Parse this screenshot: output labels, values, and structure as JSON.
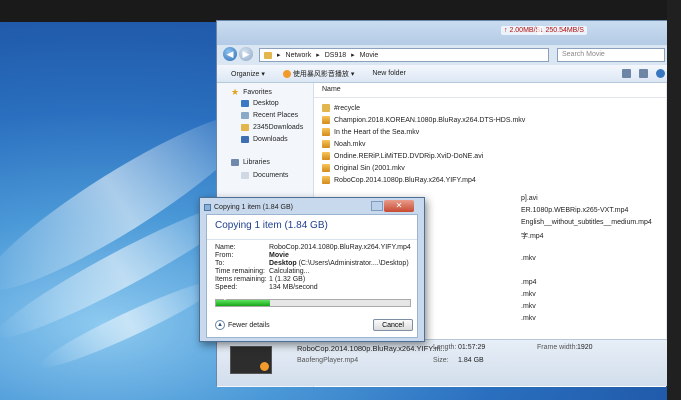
{
  "window": {
    "transfer_up": "↑ 2.00MB/S",
    "transfer_down": "↓ 250.54MB/S",
    "breadcrumb": [
      "Network",
      "DS918",
      "Movie"
    ],
    "search_placeholder": "Search Movie",
    "back_glyph": "◀",
    "forward_glyph": "▶"
  },
  "toolbar": {
    "organize": "Organize ▾",
    "baofeng": "使用暴风影音播放 ▾",
    "new_folder": "New folder"
  },
  "sidebar": {
    "favorites_header": "Favorites",
    "favorites": [
      "Desktop",
      "Recent Places",
      "2345Downloads",
      "Downloads"
    ],
    "libraries_header": "Libraries",
    "libraries": [
      "Documents"
    ]
  },
  "file_list": {
    "column_name": "Name",
    "column_date_partial": "Da",
    "files": [
      "#recycle",
      "Champion.2018.KOREAN.1080p.BluRay.x264.DTS-HDS.mkv",
      "In the Heart of the Sea.mkv",
      "Noah.mkv",
      "Ondine.RERiP.LiMiTED.DVDRip.XviD-DoNE.avi",
      "Original Sin (2001.mkv",
      "RoboCop.2014.1080p.BluRay.x264.YIFY.mp4"
    ],
    "partial_names": [
      "p].avi",
      "ER.1080p.WEBRip.x265-VXT.mp4",
      "English__without_subtitles__medium.mp4",
      "字.mp4",
      ".mkv",
      ".mp4",
      ".mkv",
      ".mkv",
      ".mkv"
    ],
    "date_fragments": [
      "8/",
      "9/",
      "8/",
      "8/",
      "8/",
      "8/",
      "9/",
      "8/",
      "10",
      "8/",
      "9/",
      "8/",
      "9/",
      "8/",
      "10",
      "2/",
      "10",
      "11"
    ]
  },
  "details": {
    "title": "RoboCop.2014.1080p.BluRay.x264.YIFY.m...",
    "subtitle": "BaofengPlayer.mp4",
    "length_label": "Length:",
    "length_value": "01:57:29",
    "size_label": "Size:",
    "size_value": "1.84 GB",
    "frame_width_label": "Frame width:",
    "frame_width_value": "1920"
  },
  "dialog": {
    "title": "Copying 1 item (1.84 GB)",
    "heading": "Copying 1 item (1.84 GB)",
    "close_glyph": "✕",
    "rows": [
      {
        "label": "Name:",
        "value": "RoboCop.2014.1080p.BluRay.x264.YIFY.mp4"
      },
      {
        "label": "From:",
        "value": "Movie"
      },
      {
        "label": "To:",
        "value": "Desktop",
        "value_extra": "(C:\\Users\\Administrator....\\Desktop)"
      },
      {
        "label": "Time remaining:",
        "value": "Calculating..."
      },
      {
        "label": "Items remaining:",
        "value": "1 (1.32 GB)"
      },
      {
        "label": "Speed:",
        "value": "134 MB/second"
      }
    ],
    "progress_fraction": 0.28,
    "fewer_details": "Fewer details",
    "cancel": "Cancel"
  },
  "colors": {
    "accent": "#1f3f8f",
    "progress": "#17a517",
    "transfer": "#b01010"
  }
}
